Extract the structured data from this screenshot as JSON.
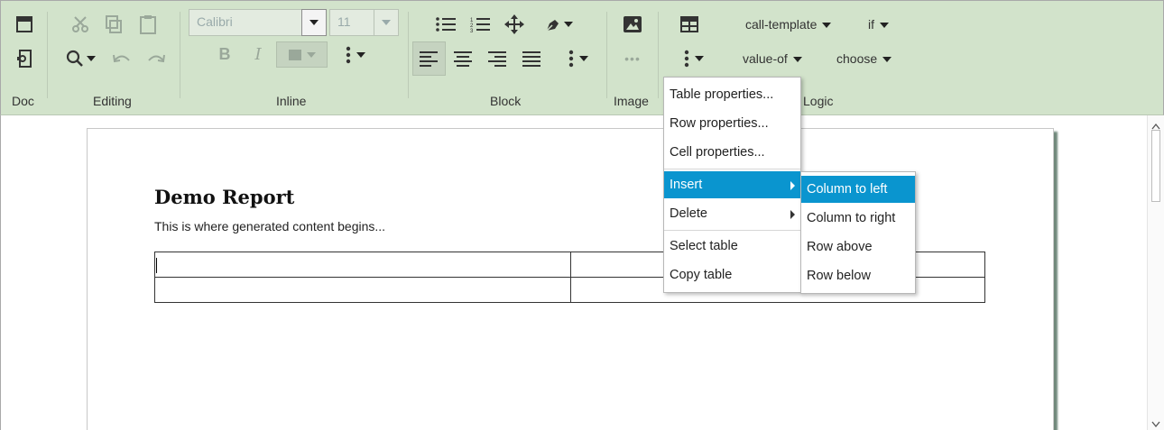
{
  "toolbar": {
    "groups": {
      "doc": "Doc",
      "editing": "Editing",
      "inline": "Inline",
      "block": "Block",
      "image": "Image",
      "logic": "Logic"
    },
    "font_name_placeholder": "Calibri",
    "font_size_placeholder": "11",
    "logic_items": [
      "call-template",
      "if",
      "value-of",
      "choose"
    ]
  },
  "document": {
    "title": "Demo Report",
    "paragraph": "This is where generated content begins..."
  },
  "context_menu": {
    "items": [
      "Table properties...",
      "Row properties...",
      "Cell properties...",
      "Insert",
      "Delete",
      "Select table",
      "Copy table"
    ],
    "highlighted": "Insert"
  },
  "submenu": {
    "items": [
      "Column to left",
      "Column to right",
      "Row above",
      "Row below"
    ],
    "highlighted": "Column to left"
  },
  "colors": {
    "ribbon_bg": "#d2e3cb",
    "menu_highlight": "#0a95cf"
  }
}
